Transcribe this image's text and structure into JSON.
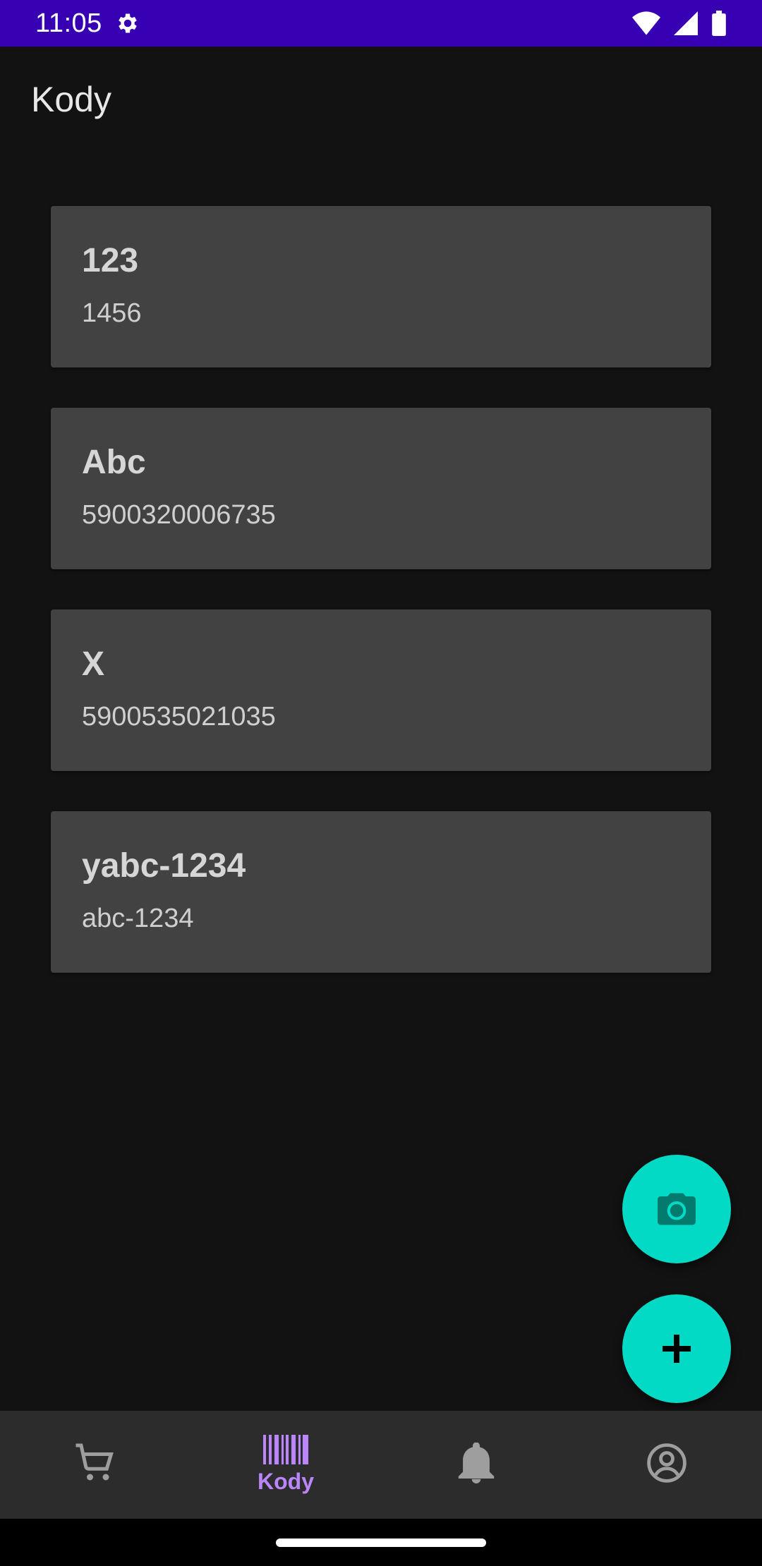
{
  "status_bar": {
    "time": "11:05"
  },
  "app_bar": {
    "title": "Kody"
  },
  "codes": [
    {
      "name": "123",
      "value": "1456"
    },
    {
      "name": "Abc",
      "value": "5900320006735"
    },
    {
      "name": "X",
      "value": "5900535021035"
    },
    {
      "name": "yabc-1234",
      "value": "abc-1234"
    }
  ],
  "fabs": {
    "camera_icon": "camera-icon",
    "add_icon": "plus-icon"
  },
  "bottom_nav": {
    "items": [
      {
        "icon": "cart-icon",
        "label": ""
      },
      {
        "icon": "barcode-icon",
        "label": "Kody"
      },
      {
        "icon": "bell-icon",
        "label": ""
      },
      {
        "icon": "account-circle-icon",
        "label": ""
      }
    ]
  },
  "colors": {
    "status_bar": "#3700b3",
    "background": "#121212",
    "card": "#424242",
    "fab": "#03dac5",
    "nav_active": "#bb86fc",
    "nav_inactive": "#9e9e9e"
  }
}
